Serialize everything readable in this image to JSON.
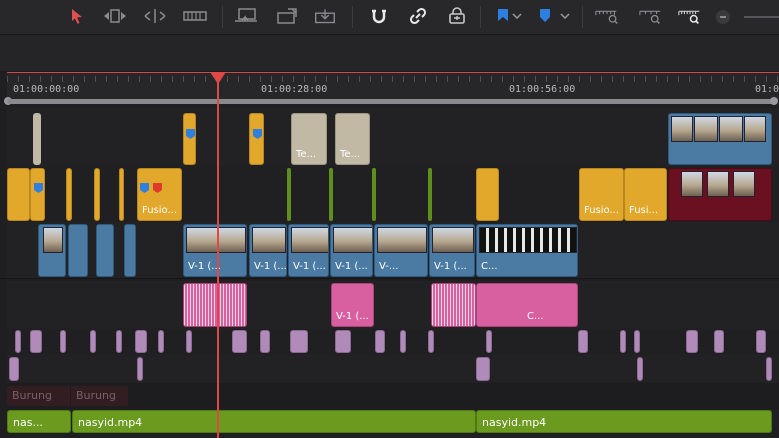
{
  "toolbar": {
    "icons": [
      "pointer-icon",
      "trim-icon",
      "dynamic-trim-icon",
      "blade-icon",
      "insert-icon",
      "overwrite-icon",
      "replace-icon",
      "snap-icon",
      "link-icon",
      "lock-icon",
      "flag-icon",
      "marker-icon",
      "zoom-full-icon",
      "zoom-detail-icon",
      "zoom-custom-icon"
    ],
    "colors": {
      "pointer": "#e05050",
      "flag": "#2e7fe0",
      "marker": "#2e7fe0"
    }
  },
  "ruler": {
    "labels": [
      "01:00:00:00",
      "01:00:28:00",
      "01:00:56:00",
      "01:0"
    ]
  },
  "video_clips": {
    "v3_beige_1": "Te...",
    "v3_beige_2": "Te...",
    "v2_fusion_1": "Fusio...",
    "v2_fusion_2": "Fusio...",
    "v2_fusion_3": "Fusi...",
    "v1_labels": [
      "V-1 (...",
      "V-1 (...",
      "V-1 (...",
      "V-1 (...",
      "V-...",
      "V-1 (...",
      "C..."
    ]
  },
  "audio_clips": {
    "a1_labels": [
      "V-1 (...",
      "C..."
    ],
    "track_name_1": "Burung",
    "track_name_2": "Burung",
    "music_1": "nas...",
    "music_2": "nasyid.mp4",
    "music_3": "nasyid.mp4"
  },
  "colors": {
    "playhead": "#e04848",
    "yellow_clip": "#e1a82b",
    "blue_clip": "#4b7ba3",
    "pink_clip": "#d85fa0",
    "green_audio": "#6a9a1e",
    "maroon_clip": "#6b1020"
  }
}
